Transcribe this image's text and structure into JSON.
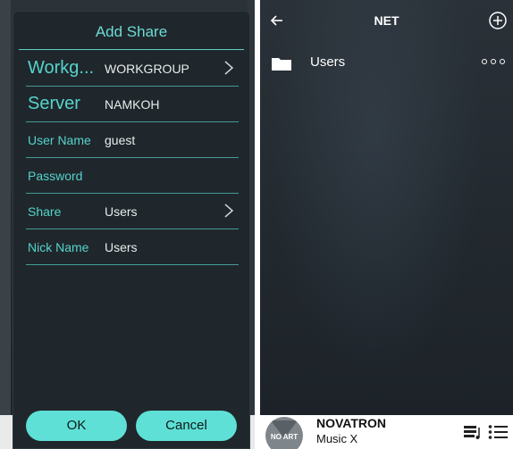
{
  "dialog": {
    "title": "Add Share",
    "fields": [
      {
        "label": "Workg...",
        "value": "WORKGROUP",
        "chevron": true
      },
      {
        "label": "Server",
        "value": "NAMKOH",
        "chevron": false
      },
      {
        "label": "User Name",
        "value": "guest",
        "chevron": false
      },
      {
        "label": "Password",
        "value": "",
        "chevron": false
      },
      {
        "label": "Share",
        "value": "Users",
        "chevron": true
      },
      {
        "label": "Nick Name",
        "value": "Users",
        "chevron": false
      }
    ],
    "ok_label": "OK",
    "cancel_label": "Cancel"
  },
  "browser": {
    "title": "NET",
    "items": [
      {
        "name": "Users",
        "icon": "folder-icon"
      }
    ]
  },
  "player": {
    "art_text": "NO ART",
    "track": "NOVATRON",
    "app": "Music X"
  },
  "colors": {
    "accent": "#5fe0d6",
    "label": "#56d3cb",
    "dialog_bg": "#1f272c"
  }
}
